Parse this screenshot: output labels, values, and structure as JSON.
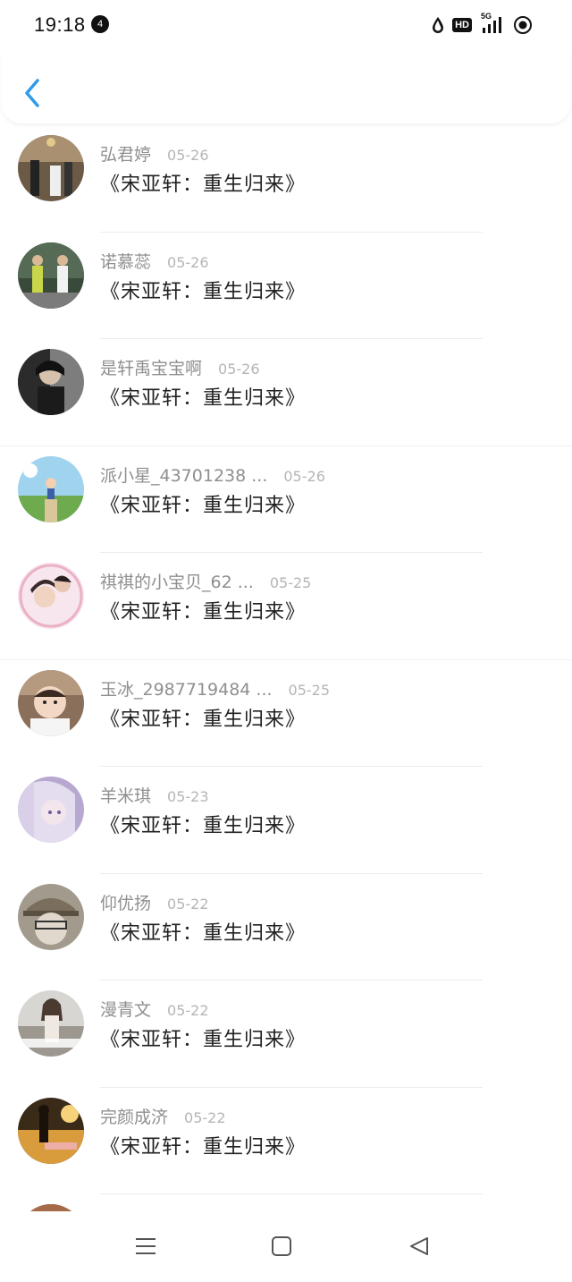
{
  "status_bar": {
    "time": "19:18",
    "notification_badge": "4",
    "hd_label": "HD",
    "network_label": "5G"
  },
  "header": {
    "back_icon": "chevron-left-icon",
    "accent_color": "#2f9be8"
  },
  "entries": [
    {
      "name": "弘君婷",
      "date": "05-26",
      "title": "《宋亚轩：重生归来》"
    },
    {
      "name": "诺慕蕊",
      "date": "05-26",
      "title": "《宋亚轩：重生归来》"
    },
    {
      "name": "是轩禹宝宝啊",
      "date": "05-26",
      "title": "《宋亚轩：重生归来》"
    },
    {
      "name": "派小星_43701238 ...",
      "date": "05-26",
      "title": "《宋亚轩：重生归来》"
    },
    {
      "name": "祺祺的小宝贝_62 ...",
      "date": "05-25",
      "title": "《宋亚轩：重生归来》"
    },
    {
      "name": "玉冰_2987719484 ...",
      "date": "05-25",
      "title": "《宋亚轩：重生归来》"
    },
    {
      "name": "羊米琪",
      "date": "05-23",
      "title": "《宋亚轩：重生归来》"
    },
    {
      "name": "仰优扬",
      "date": "05-22",
      "title": "《宋亚轩：重生归来》"
    },
    {
      "name": "漫青文",
      "date": "05-22",
      "title": "《宋亚轩：重生归来》"
    },
    {
      "name": "完颜成济",
      "date": "05-22",
      "title": "《宋亚轩：重生归来》"
    }
  ],
  "nav_bar": {
    "menu_icon": "menu-icon",
    "home_icon": "home-square-icon",
    "back_icon": "back-triangle-icon"
  }
}
